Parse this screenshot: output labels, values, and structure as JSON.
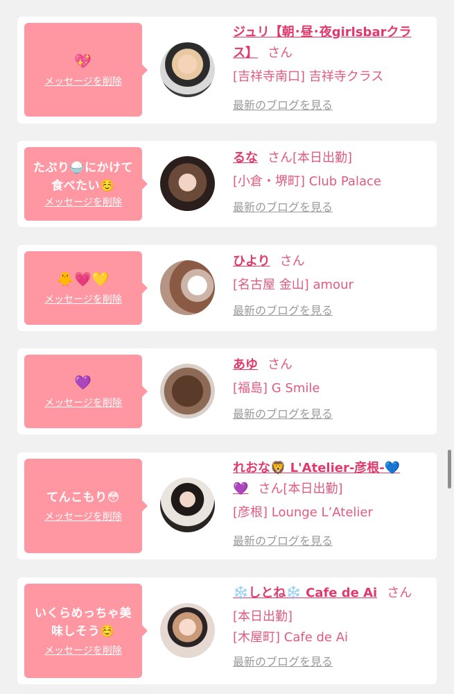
{
  "entries": [
    {
      "message_lines": [
        ""
      ],
      "message_emoji": "💖",
      "delete_label": "メッセージを削除",
      "name_lines": [
        "ジュリ【朝･昼･夜girlsbarクラ",
        "ス】"
      ],
      "honorific": "さん",
      "shop_lines": [
        "[吉祥寺南口] 吉祥寺クラス"
      ],
      "blog_label": "最新のブログを見る"
    },
    {
      "message_lines": [
        "たぷり🍚にかけて",
        "食べたい☺️"
      ],
      "delete_label": "メッセージを削除",
      "name": "るな",
      "honorific": "さん",
      "status": "[本日出勤]",
      "shop_lines": [
        "[小倉・堺町] Club Palace"
      ],
      "blog_label": "最新のブログを見る"
    },
    {
      "message_emoji": "🐥💗💛",
      "delete_label": "メッセージを削除",
      "name": "ひより",
      "honorific": "さん",
      "shop_lines": [
        "[名古屋 金山] amour"
      ],
      "blog_label": "最新のブログを見る"
    },
    {
      "message_emoji": "💜",
      "delete_label": "メッセージを削除",
      "name": "あゆ",
      "honorific": "さん",
      "shop_lines": [
        "[福島] G Smile"
      ],
      "blog_label": "最新のブログを見る"
    },
    {
      "message_lines": [
        "てんこもり😳"
      ],
      "delete_label": "メッセージを削除",
      "name_lines": [
        "れおな🦁 L'Atelier-彦根-💙",
        "💜"
      ],
      "honorific": "さん",
      "status": "[本日出勤]",
      "shop_lines": [
        "[彦根] Lounge L’Atelier"
      ],
      "blog_label": "最新のブログを見る"
    },
    {
      "message_lines": [
        "いくらめっちゃ美",
        "味しそう☺️"
      ],
      "delete_label": "メッセージを削除",
      "name": "❄️しとね❄️ Cafe de Ai",
      "honorific": "さん",
      "status": "[本日出勤]",
      "shop_lines": [
        "[木屋町] Cafe de Ai"
      ],
      "blog_label": "最新のブログを見る"
    }
  ],
  "colors": {
    "page_bg": "#f1f1f1",
    "card_bg": "#ffffff",
    "bubble_bg": "#ff97a3",
    "name": "#e03a6c",
    "shop": "#e25a7f",
    "blog_link": "#9a9a9a"
  }
}
